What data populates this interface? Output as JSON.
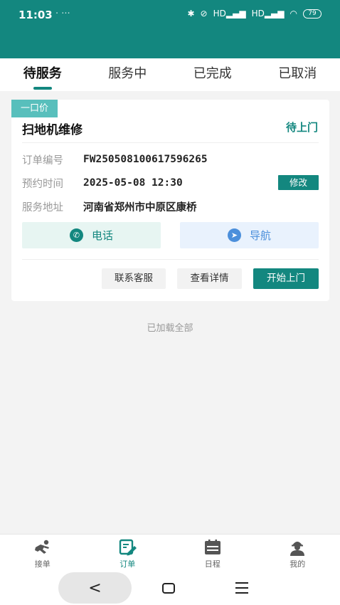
{
  "status_bar": {
    "time": "11:03",
    "dots": "· ···",
    "signal_label": "HD",
    "battery": "79"
  },
  "tabs": [
    {
      "label": "待服务",
      "active": true
    },
    {
      "label": "服务中",
      "active": false
    },
    {
      "label": "已完成",
      "active": false
    },
    {
      "label": "已取消",
      "active": false
    }
  ],
  "order": {
    "price_tag": "一口价",
    "title": "扫地机维修",
    "status": "待上门",
    "fields": {
      "order_no_label": "订单编号",
      "order_no": "FW250508100617596265",
      "time_label": "预约时间",
      "time": "2025-05-08 12:30",
      "modify_label": "修改",
      "address_label": "服务地址",
      "address": "河南省郑州市中原区康桥"
    },
    "actions": {
      "phone": "电话",
      "navigate": "导航"
    },
    "buttons": {
      "contact": "联系客服",
      "details": "查看详情",
      "start": "开始上门"
    }
  },
  "list_footer": "已加载全部",
  "bottom_nav": [
    {
      "label": "接单",
      "icon": "runner-icon",
      "active": false
    },
    {
      "label": "订单",
      "icon": "order-edit-icon",
      "active": true
    },
    {
      "label": "日程",
      "icon": "calendar-icon",
      "active": false
    },
    {
      "label": "我的",
      "icon": "profile-icon",
      "active": false
    }
  ],
  "system_nav": {
    "back": "<"
  },
  "colors": {
    "primary": "#13877f",
    "tag": "#58bfbc",
    "nav_blue": "#4b8fdb"
  }
}
